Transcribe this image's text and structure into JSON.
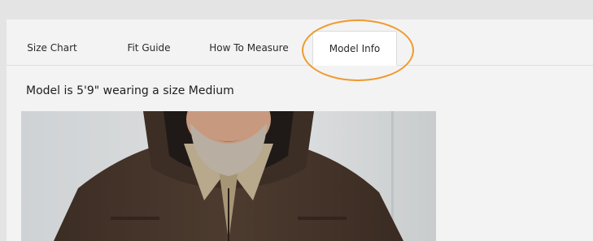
{
  "tabs": {
    "items": [
      {
        "label": "Size Chart"
      },
      {
        "label": "Fit Guide"
      },
      {
        "label": "How To Measure"
      },
      {
        "label": "Model Info"
      }
    ],
    "active": "Model Info"
  },
  "model_info": {
    "caption": "Model is 5'9\" wearing a size Medium"
  },
  "colors": {
    "page_bg": "#e4e4e4",
    "panel_bg": "#f3f3f3",
    "active_tab_bg": "#ffffff",
    "highlight": "#ef9a2d",
    "jacket": "#4a382c",
    "shirt": "#b8a88c"
  },
  "photo": {
    "subject": "model-photo"
  }
}
